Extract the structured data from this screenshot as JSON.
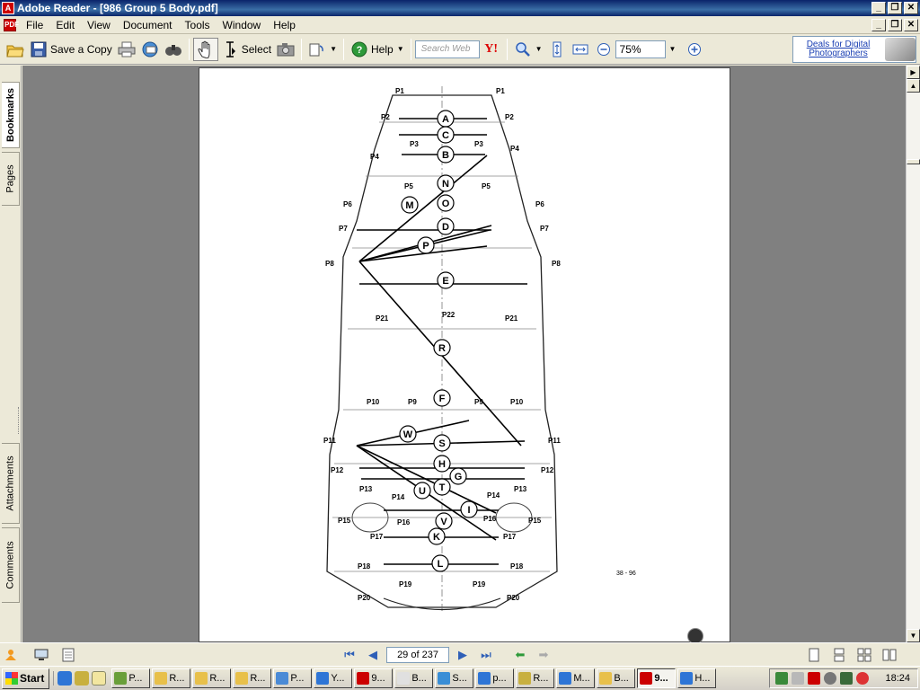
{
  "window": {
    "title": "Adobe Reader - [986 Group 5 Body.pdf]",
    "buttons": {
      "minimize": "_",
      "restore": "❐",
      "close": "✕"
    }
  },
  "menu": {
    "items": [
      "File",
      "Edit",
      "View",
      "Document",
      "Tools",
      "Window",
      "Help"
    ]
  },
  "toolbar": {
    "save_copy_label": "Save a Copy",
    "select_label": "Select",
    "help_label": "Help",
    "search_placeholder": "Search Web",
    "zoom_value": "75%",
    "ad_text": "Deals for Digital Photographers"
  },
  "nav_tabs": {
    "bookmarks": "Bookmarks",
    "pages": "Pages",
    "attachments": "Attachments",
    "comments": "Comments"
  },
  "status": {
    "page_indicator": "29 of 237"
  },
  "diagram": {
    "figure_number": "38 - 96",
    "letters": [
      "A",
      "C",
      "B",
      "N",
      "O",
      "M",
      "D",
      "P",
      "E",
      "R",
      "F",
      "W",
      "S",
      "H",
      "G",
      "T",
      "U",
      "I",
      "V",
      "K",
      "L"
    ],
    "points": [
      "P1",
      "P1",
      "P2",
      "P2",
      "P3",
      "P3",
      "P4",
      "P4",
      "P5",
      "P5",
      "P6",
      "P6",
      "P7",
      "P7",
      "P8",
      "P8",
      "P21",
      "P22",
      "P21",
      "P9",
      "P9",
      "P10",
      "P10",
      "P11",
      "P11",
      "P12",
      "P12",
      "P13",
      "P13",
      "P14",
      "P14",
      "P15",
      "P15",
      "P16",
      "P16",
      "P17",
      "P17",
      "P18",
      "P18",
      "P19",
      "P19",
      "P20",
      "P20"
    ]
  },
  "taskbar": {
    "start_label": "Start",
    "tasks": [
      "P...",
      "R...",
      "R...",
      "R...",
      "P...",
      "Y...",
      "9...",
      "B...",
      "S...",
      "p...",
      "R...",
      "M...",
      "B...",
      "9...",
      "H..."
    ],
    "active_task_index": 13,
    "clock": "18:24"
  }
}
